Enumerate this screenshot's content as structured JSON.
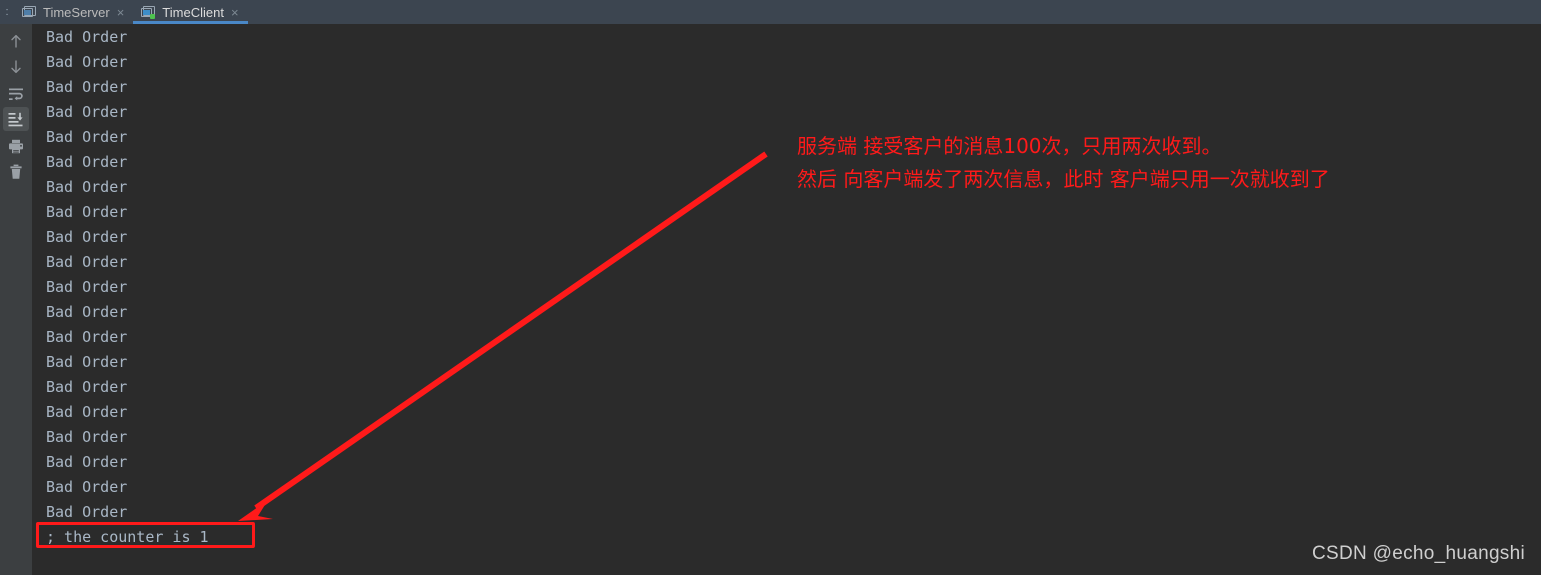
{
  "tabbar": {
    "leader": ":",
    "tabs": [
      {
        "label": "TimeServer",
        "icon": "console-screen-icon",
        "active": false,
        "running": false,
        "close": "×"
      },
      {
        "label": "TimeClient",
        "icon": "console-screen-running-icon",
        "active": true,
        "running": true,
        "close": "×"
      }
    ]
  },
  "toolbar": {
    "buttons": [
      {
        "name": "up-arrow-icon",
        "label": "Up the Stack Trace",
        "glyph": "↑",
        "selected": false
      },
      {
        "name": "down-arrow-icon",
        "label": "Down the Stack Trace",
        "glyph": "↓",
        "selected": false
      },
      {
        "name": "soft-wrap-icon",
        "label": "Soft-Wrap",
        "glyph": "",
        "selected": false
      },
      {
        "name": "scroll-to-end-icon",
        "label": "Scroll to the end",
        "glyph": "",
        "selected": true
      },
      {
        "name": "print-icon",
        "label": "Print",
        "glyph": "",
        "selected": false
      },
      {
        "name": "trash-icon",
        "label": "Clear All",
        "glyph": "",
        "selected": false
      }
    ]
  },
  "console": {
    "lines": [
      {
        "text": "Bad Order",
        "highlight": false
      },
      {
        "text": "Bad Order",
        "highlight": false
      },
      {
        "text": "Bad Order",
        "highlight": false
      },
      {
        "text": "Bad Order",
        "highlight": false
      },
      {
        "text": "Bad Order",
        "highlight": false
      },
      {
        "text": "Bad Order",
        "highlight": false
      },
      {
        "text": "Bad Order",
        "highlight": false
      },
      {
        "text": "Bad Order",
        "highlight": false
      },
      {
        "text": "Bad Order",
        "highlight": false
      },
      {
        "text": "Bad Order",
        "highlight": false
      },
      {
        "text": "Bad Order",
        "highlight": false
      },
      {
        "text": "Bad Order",
        "highlight": false
      },
      {
        "text": "Bad Order",
        "highlight": false
      },
      {
        "text": "Bad Order",
        "highlight": false
      },
      {
        "text": "Bad Order",
        "highlight": false
      },
      {
        "text": "Bad Order",
        "highlight": false
      },
      {
        "text": "Bad Order",
        "highlight": false
      },
      {
        "text": "Bad Order",
        "highlight": false
      },
      {
        "text": "Bad Order",
        "highlight": false
      },
      {
        "text": "Bad Order",
        "highlight": false
      },
      {
        "text": "; the counter is 1",
        "highlight": true
      }
    ]
  },
  "annotation": {
    "line1": "服务端 接受客户的消息100次，只用两次收到。",
    "line2": "然后 向客户端发了两次信息，此时 客户端只用一次就收到了",
    "color": "#ff1a1a"
  },
  "watermark": {
    "text": "CSDN @echo_huangshi"
  }
}
